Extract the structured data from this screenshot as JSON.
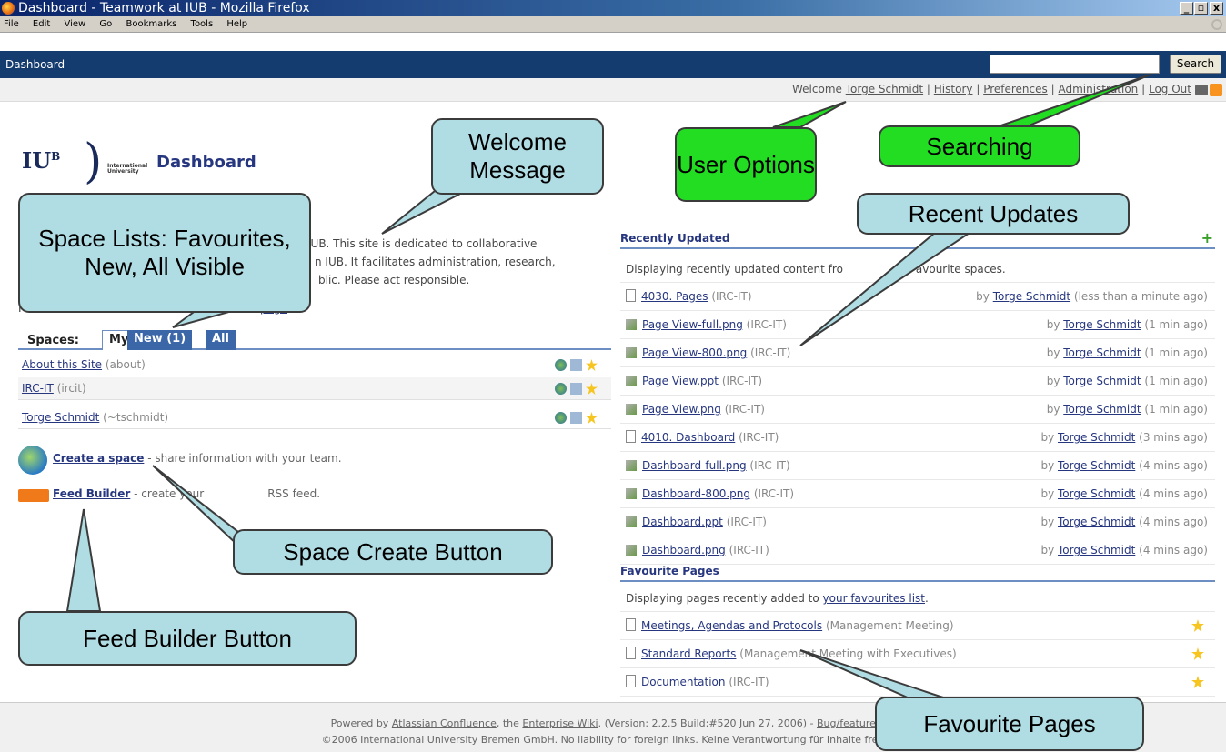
{
  "window": {
    "title": "Dashboard - Teamwork at IUB - Mozilla Firefox",
    "min": "_",
    "max": "▫",
    "close": "x"
  },
  "menu": [
    "File",
    "Edit",
    "View",
    "Go",
    "Bookmarks",
    "Tools",
    "Help"
  ],
  "nav": {
    "title": "Dashboard",
    "search_value": "",
    "search_button": "Search"
  },
  "userbar": {
    "welcome": "Welcome",
    "user": "Torge Schmidt",
    "sep": "|",
    "history": "History",
    "preferences": "Preferences",
    "administration": "Administration",
    "logout": "Log Out"
  },
  "logo": {
    "iu": "IU",
    "sup": "B",
    "intl1": "International",
    "intl2": "University"
  },
  "page_title": "Dashboard",
  "intro": {
    "line1": "IUB. This site is dedicated to collaborative",
    "line2": "n IUB. It facilitates administration, research,",
    "line3": "blic. Please act responsible.",
    "for_prefix": "Fo",
    "page_link": "page"
  },
  "spaces": {
    "label": "Spaces:",
    "tabs": [
      "My",
      "New (1)",
      "All"
    ],
    "rows": [
      {
        "name": "About this Site",
        "key": "(about)"
      },
      {
        "name": "IRC-IT",
        "key": "(ircit)"
      },
      {
        "name": "Torge Schmidt",
        "key": "(~tschmidt)"
      }
    ]
  },
  "create_space": {
    "link": "Create a space",
    "desc": "- share information with your team."
  },
  "feed_builder": {
    "link": "Feed Builder",
    "desc": "- create your",
    "desc2": "RSS feed."
  },
  "recent": {
    "title": "Recently Updated",
    "plus": "+",
    "intro": "Displaying recently updated content fro",
    "intro2": "avourite spaces.",
    "items": [
      {
        "name": "4030. Pages",
        "space": "(IRC-IT)",
        "by": "by",
        "user": "Torge Schmidt",
        "when": "(less than a minute ago)",
        "kind": "doc"
      },
      {
        "name": "Page View-full.png",
        "space": "(IRC-IT)",
        "by": "by",
        "user": "Torge Schmidt",
        "when": "(1 min ago)",
        "kind": "img"
      },
      {
        "name": "Page View-800.png",
        "space": "(IRC-IT)",
        "by": "by",
        "user": "Torge Schmidt",
        "when": "(1 min ago)",
        "kind": "img"
      },
      {
        "name": "Page View.ppt",
        "space": "(IRC-IT)",
        "by": "by",
        "user": "Torge Schmidt",
        "when": "(1 min ago)",
        "kind": "img"
      },
      {
        "name": "Page View.png",
        "space": "(IRC-IT)",
        "by": "by",
        "user": "Torge Schmidt",
        "when": "(1 min ago)",
        "kind": "img"
      },
      {
        "name": "4010. Dashboard",
        "space": "(IRC-IT)",
        "by": "by",
        "user": "Torge Schmidt",
        "when": "(3 mins ago)",
        "kind": "doc"
      },
      {
        "name": "Dashboard-full.png",
        "space": "(IRC-IT)",
        "by": "by",
        "user": "Torge Schmidt",
        "when": "(4 mins ago)",
        "kind": "img"
      },
      {
        "name": "Dashboard-800.png",
        "space": "(IRC-IT)",
        "by": "by",
        "user": "Torge Schmidt",
        "when": "(4 mins ago)",
        "kind": "img"
      },
      {
        "name": "Dashboard.ppt",
        "space": "(IRC-IT)",
        "by": "by",
        "user": "Torge Schmidt",
        "when": "(4 mins ago)",
        "kind": "img"
      },
      {
        "name": "Dashboard.png",
        "space": "(IRC-IT)",
        "by": "by",
        "user": "Torge Schmidt",
        "when": "(4 mins ago)",
        "kind": "img"
      }
    ]
  },
  "favourites": {
    "title": "Favourite Pages",
    "intro": "Displaying pages recently added to",
    "link": "your favourites list",
    "dot": ".",
    "items": [
      {
        "name": "Meetings, Agendas and Protocols",
        "space": "(Management Meeting)"
      },
      {
        "name": "Standard Reports",
        "space": "(Management Meeting with Executives)"
      },
      {
        "name": "Documentation",
        "space": "(IRC-IT)"
      }
    ]
  },
  "footer": {
    "line1a": "Powered by",
    "l1": "Atlassian Confluence",
    "line1b": ", the",
    "l2": "Enterprise Wiki",
    "line1c": ". (Version: 2.2.5 Build:#520 Jun 27, 2006) -",
    "l3": "Bug/feature req",
    "line2": "©2006 International University Bremen GmbH. No liability for foreign links. Keine Verantwortung für Inhalte fremder"
  },
  "callouts": {
    "welcome": "Welcome Message",
    "user_options": "User Options",
    "searching": "Searching",
    "space_lists": "Space Lists: Favourites, New, All Visible",
    "recent_updates": "Recent Updates",
    "space_create": "Space Create Button",
    "feed_builder": "Feed Builder Button",
    "favourite_pages": "Favourite Pages"
  },
  "colors": {
    "nav": "#143c6e",
    "callout_blue": "#b0dde3",
    "callout_green": "#22dd22",
    "tab_blue": "#3b66a8",
    "link": "#26367f"
  }
}
